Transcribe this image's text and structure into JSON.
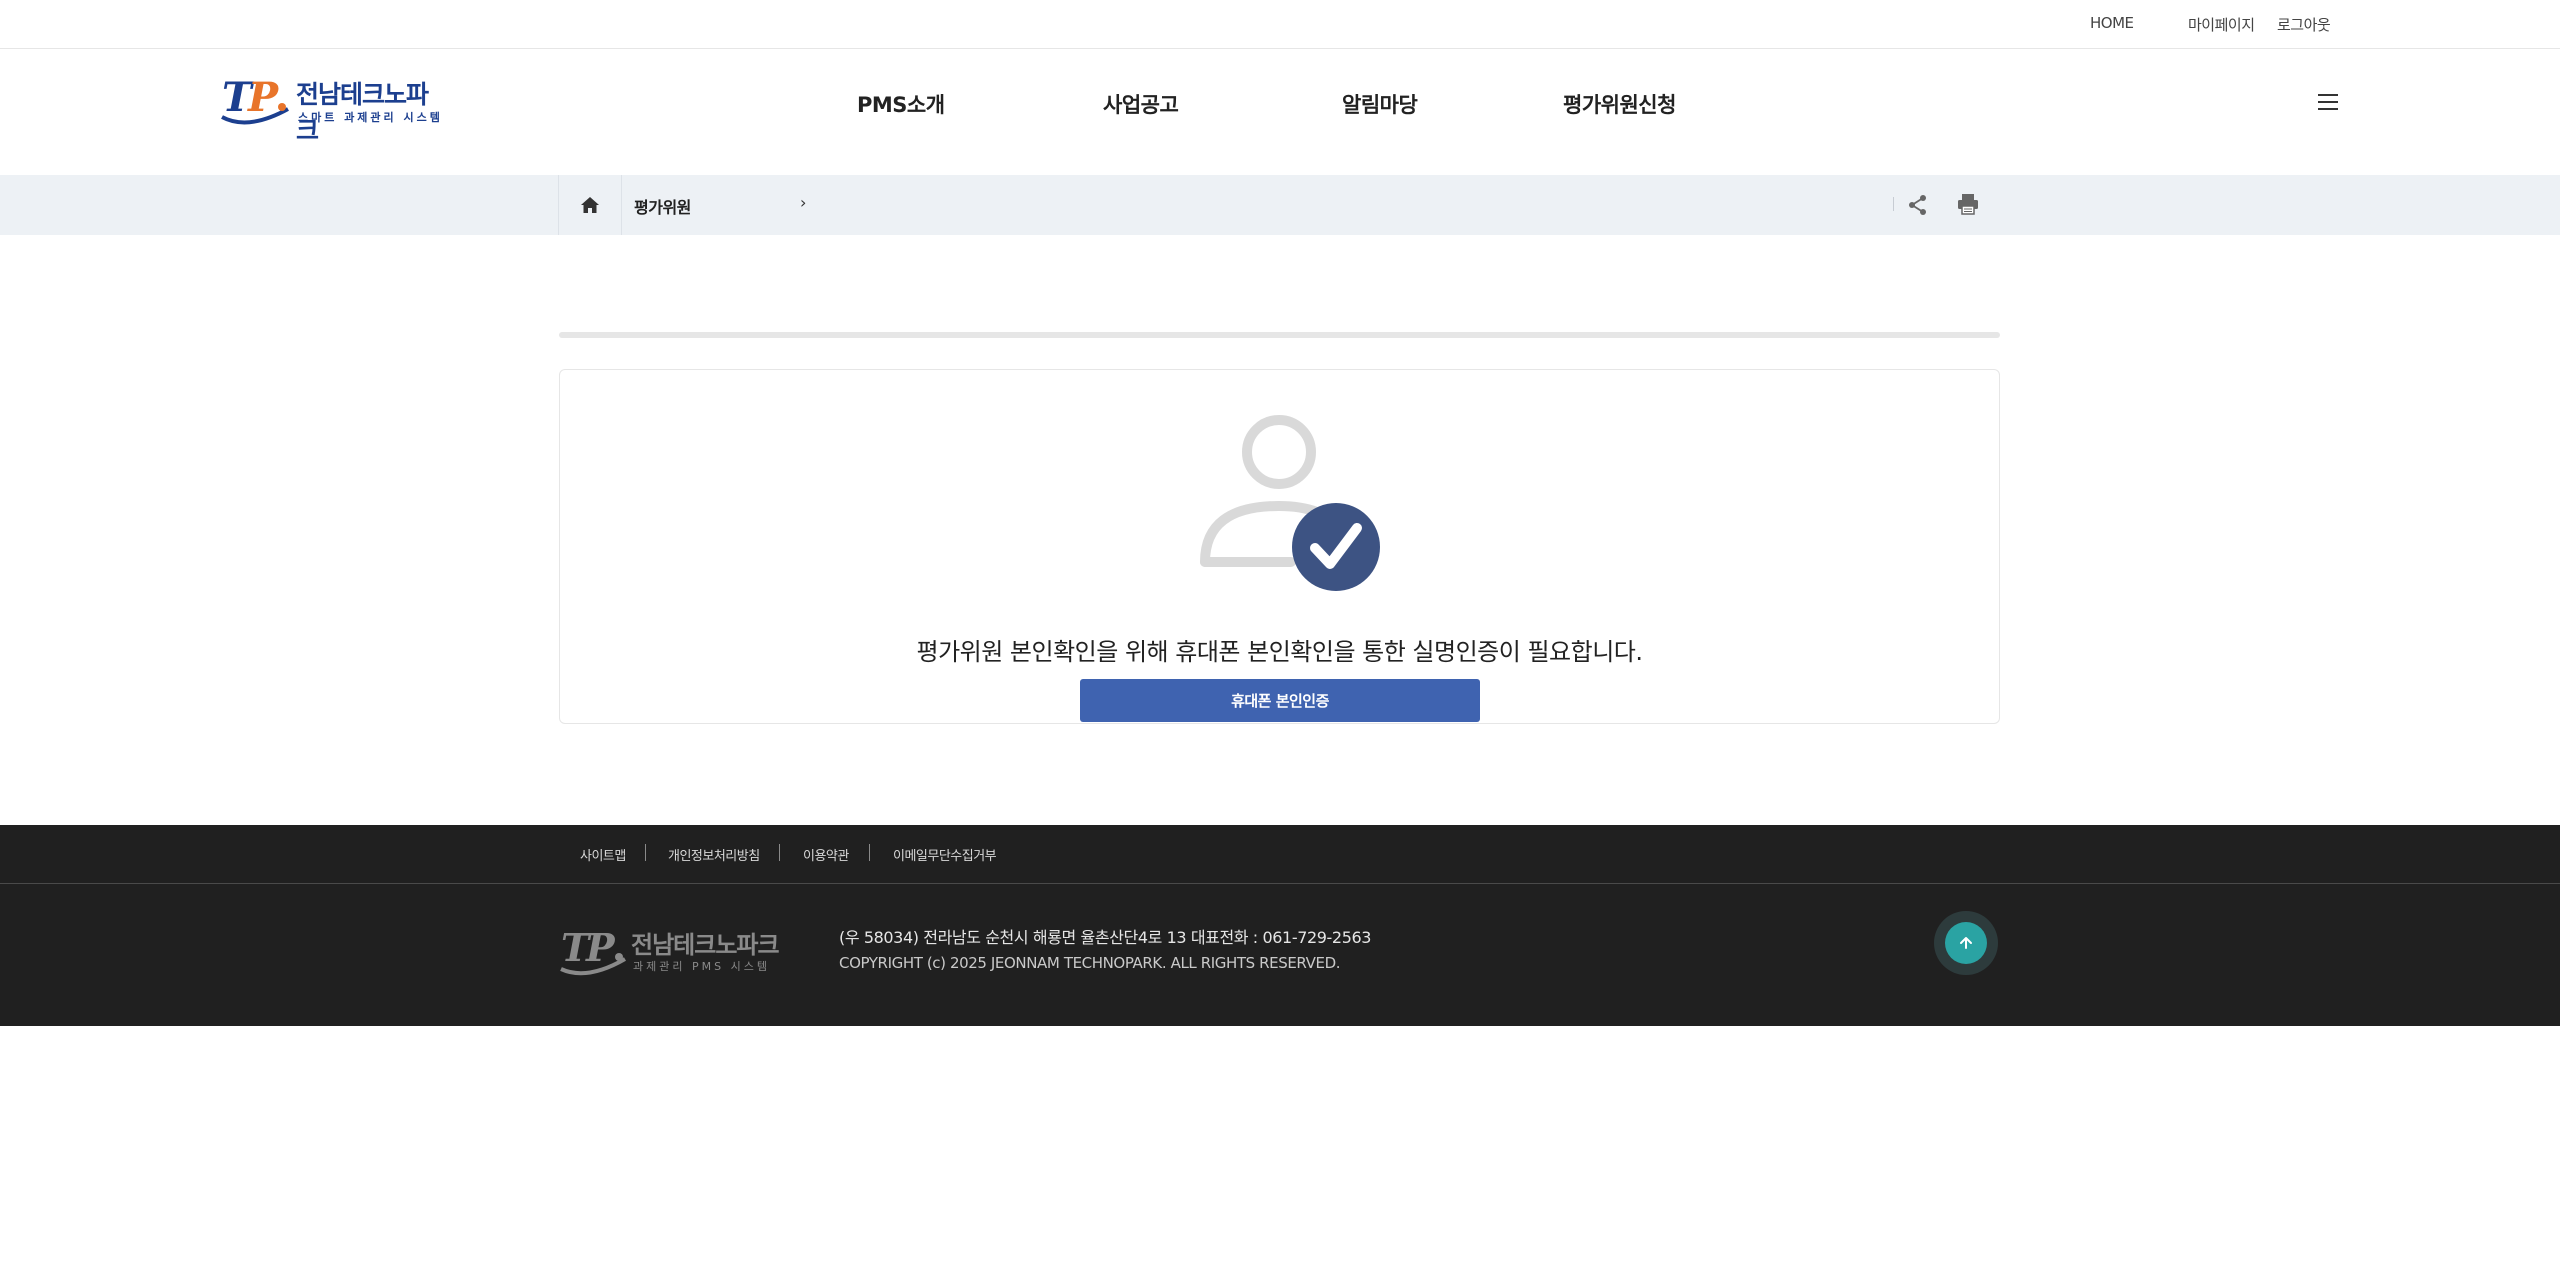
{
  "util_nav": {
    "home": "HOME",
    "mypage": "마이페이지",
    "logout": "로그아웃"
  },
  "header": {
    "logo_title": "전남테크노파크",
    "logo_sub": "스마트 과제관리 시스템",
    "logo_mark": "TP",
    "menu": [
      "PMS소개",
      "사업공고",
      "알림마당",
      "평가위원신청"
    ],
    "menu_icon": "hamburger-icon"
  },
  "breadcrumb": {
    "home_icon": "home-icon",
    "current": "평가위원",
    "arrow": "›",
    "share_icon": "share-icon",
    "print_icon": "print-icon"
  },
  "content": {
    "icon": "user-check-icon",
    "message": "평가위원 본인확인을 위해 휴대폰 본인확인을 통한 실명인증이 필요합니다.",
    "button": "휴대폰 본인인증"
  },
  "footer": {
    "links": [
      "사이트맵",
      "개인정보처리방침",
      "이용약관",
      "이메일무단수집거부"
    ],
    "logo_title": "전남테크노파크",
    "logo_sub": "과제관리 PMS 시스템",
    "logo_mark": "TP",
    "address": "(우 58034) 전라남도 순천시 해룡면 율촌산단4로 13   대표전화 : 061-729-2563",
    "copyright": "COPYRIGHT (c) 2025 JEONNAM TECHNOPARK. ALL RIGHTS RESERVED.",
    "top_icon": "arrow-up-icon"
  },
  "colors": {
    "brand_blue": "#1c3f8f",
    "brand_orange": "#e8742a",
    "button_blue": "#3f63b0",
    "icon_navy": "#3d5383",
    "footer_bg": "#202020",
    "top_btn": "#2aa3a3"
  }
}
